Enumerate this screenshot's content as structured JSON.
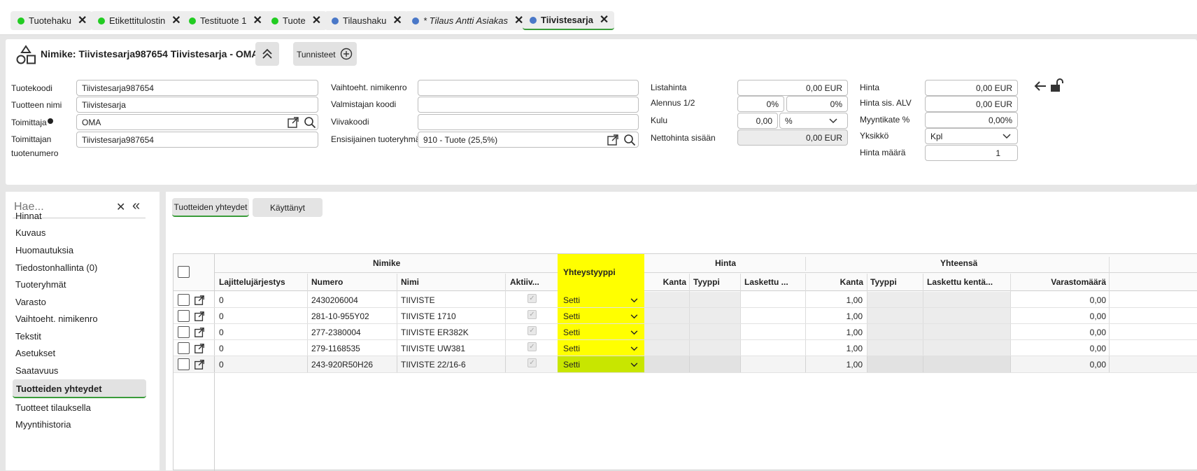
{
  "tabs": [
    {
      "label": "Tuotehaku",
      "color": "#22cc22"
    },
    {
      "label": "Etikettitulostin",
      "color": "#22cc22"
    },
    {
      "label": "Testituote 1",
      "color": "#22cc22"
    },
    {
      "label": "Tuote",
      "color": "#22cc22"
    },
    {
      "label": "Tilaushaku",
      "color": "#4a78c8"
    },
    {
      "label": "* Tilaus Antti Asiakas",
      "color": "#4a78c8"
    },
    {
      "label": "Tiivistesarja",
      "color": "#4a78c8"
    }
  ],
  "header": {
    "title": "Nimike: Tiivistesarja987654 Tiivistesarja - OMA",
    "tunnisteet": "Tunnisteet",
    "fields": {
      "tuotekoodi_label": "Tuotekoodi",
      "tuotekoodi": "Tiivistesarja987654",
      "tuotteen_nimi_label": "Tuotteen nimi",
      "tuotteen_nimi": "Tiivistesarja",
      "toimittaja_label": "Toimittaja",
      "toimittaja": "OMA",
      "toimittajan_tuotenumero_label1": "Toimittajan",
      "toimittajan_tuotenumero_label2": "tuotenumero",
      "toimittajan_tuotenumero": "Tiivistesarja987654",
      "vaihtoeht_label": "Vaihtoeht. nimikenro",
      "vaihtoeht": "",
      "valmistajan_label": "Valmistajan koodi",
      "valmistajan": "",
      "viivakoodi_label": "Viivakoodi",
      "viivakoodi": "",
      "ensisijainen_label": "Ensisijainen tuoteryhmä",
      "ensisijainen": "910 - Tuote (25,5%)",
      "listahinta_label": "Listahinta",
      "listahinta": "0,00  EUR",
      "alennus_label": "Alennus 1/2",
      "alennus1": "0%",
      "alennus2": "0%",
      "kulu_label": "Kulu",
      "kulu": "0,00",
      "kulu_unit": "%",
      "nettohinta_label": "Nettohinta sisään",
      "nettohinta": "0,00 EUR",
      "hinta_label": "Hinta",
      "hinta": "0,00 EUR",
      "hinta_alv_label": "Hinta sis. ALV",
      "hinta_alv": "0,00 EUR",
      "myyntikate_label": "Myyntikate %",
      "myyntikate": "0,00%",
      "yksikko_label": "Yksikkö",
      "yksikko": "Kpl",
      "hinta_maara_label": "Hinta määrä",
      "hinta_maara": "1"
    }
  },
  "sidebar": {
    "search_placeholder": "Hae...",
    "items": [
      "Hinnat",
      "Kuvaus",
      "Huomautuksia",
      "Tiedostonhallinta (0)",
      "Tuoteryhmät",
      "Varasto",
      "Vaihtoeht. nimikenro",
      "Tekstit",
      "Asetukset",
      "Saatavuus",
      "Tuotteiden yhteydet",
      "Tuotteet tilauksella",
      "Myyntihistoria"
    ],
    "active": "Tuotteiden yhteydet"
  },
  "main": {
    "tabs": [
      "Tuotteiden yhteydet",
      "Käyttänyt"
    ],
    "groups": {
      "nimike": "Nimike",
      "yhteystyyppi": "Yhteystyyppi",
      "hinta": "Hinta",
      "yhteensa": "Yhteensä"
    },
    "columns": [
      "Lajittelujärjestys",
      "Numero",
      "Nimi",
      "Aktiiv...",
      "Kanta",
      "Tyyppi",
      "Laskettu ...",
      "Kanta",
      "Tyyppi",
      "Laskettu kentä...",
      "Varastomäärä"
    ],
    "rows": [
      {
        "laj": "0",
        "numero": "2430206004",
        "nimi": "TIIVISTE",
        "tyyppi": "Setti",
        "kanta": "1,00",
        "varasto": "0,00"
      },
      {
        "laj": "0",
        "numero": "281-10-955Y02",
        "nimi": "TIIVISTE 1710",
        "tyyppi": "Setti",
        "kanta": "1,00",
        "varasto": "0,00"
      },
      {
        "laj": "0",
        "numero": "277-2380004",
        "nimi": "TIIVISTE ER382K",
        "tyyppi": "Setti",
        "kanta": "1,00",
        "varasto": "0,00"
      },
      {
        "laj": "0",
        "numero": "279-1168535",
        "nimi": "TIIVISTE UW381",
        "tyyppi": "Setti",
        "kanta": "1,00",
        "varasto": "0,00"
      },
      {
        "laj": "0",
        "numero": "243-920R50H26",
        "nimi": "TIIVISTE 22/16-6",
        "tyyppi": "Setti",
        "kanta": "1,00",
        "varasto": "0,00"
      }
    ],
    "highlight_color": "#ffff00"
  }
}
